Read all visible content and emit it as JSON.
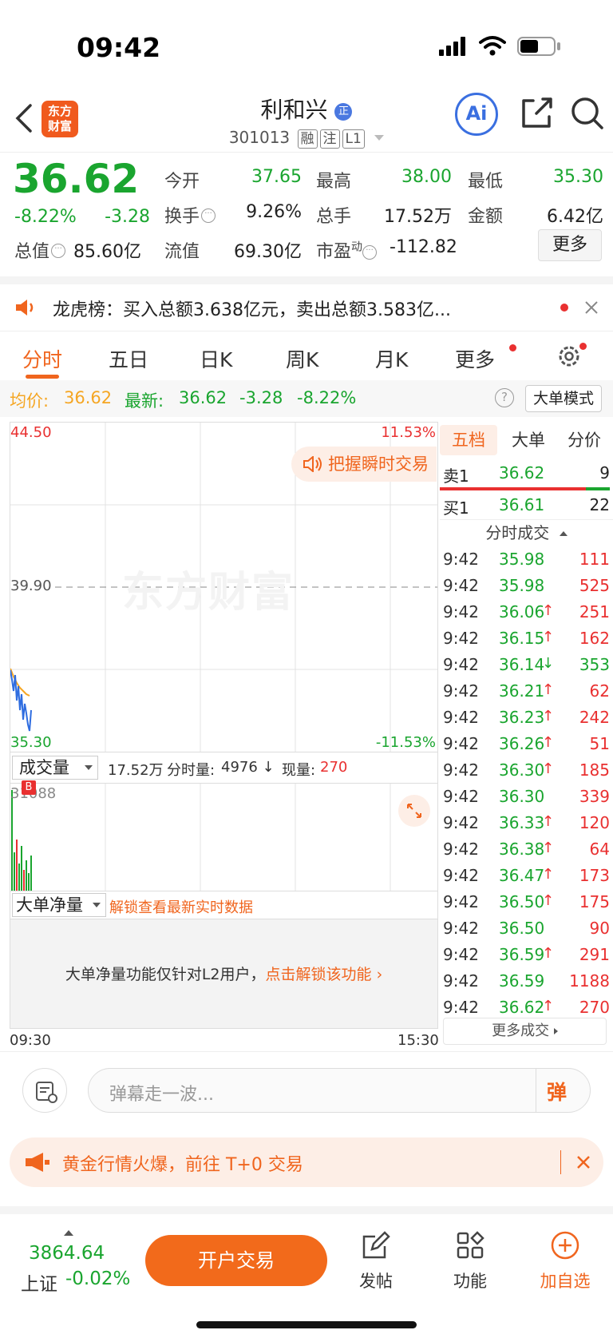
{
  "status": {
    "time": "09:42"
  },
  "header": {
    "logo_line1": "东方",
    "logo_line2": "财富",
    "stock_name": "利和兴",
    "name_badge": "正",
    "stock_code": "301013",
    "tag_rong": "融",
    "tag_zhu": "注",
    "tag_l1": "L1",
    "ai_label": "Ai"
  },
  "quote": {
    "price": "36.62",
    "change_pct": "-8.22%",
    "change": "-3.28",
    "open_label": "今开",
    "open": "37.65",
    "high_label": "最高",
    "high": "38.00",
    "low_label": "最低",
    "low": "35.30",
    "turnover_label": "换手",
    "turnover": "9.26%",
    "volume_label": "总手",
    "volume": "17.52万",
    "amount_label": "金额",
    "amount": "6.42亿",
    "mktcap_label": "总值",
    "mktcap": "85.60亿",
    "float_label": "流值",
    "float": "69.30亿",
    "pe_label": "市盈",
    "pe_sup": "动",
    "pe": "-112.82",
    "more_button": "更多"
  },
  "notice": {
    "text": "龙虎榜：买入总额3.638亿元，卖出总额3.583亿..."
  },
  "tabs": [
    "分时",
    "五日",
    "日K",
    "周K",
    "月K",
    "更多"
  ],
  "pricebar": {
    "avg_label": "均价:",
    "avg": "36.62",
    "last_label": "最新:",
    "last": "36.62",
    "change": "-3.28",
    "change_pct": "-8.22%",
    "mode_button": "大单模式"
  },
  "chart": {
    "y_top": "44.50",
    "y_mid": "39.90",
    "y_bottom": "35.30",
    "pct_top": "11.53%",
    "pct_bottom": "-11.53%",
    "watermark": "东方财富",
    "flash_trade": "把握瞬时交易",
    "time_start": "09:30",
    "time_end": "15:30"
  },
  "volume": {
    "selector": "成交量",
    "total": "17.52万",
    "minute_label": "分时量:",
    "minute": "4976",
    "current_label": "现量:",
    "current": "270",
    "max_tick": "31088",
    "b_marker": "B"
  },
  "bigorder": {
    "selector": "大单净量",
    "unlock_link": "解锁查看最新实时数据",
    "message": "大单净量功能仅针对L2用户，",
    "message_link": "点击解锁该功能"
  },
  "book": {
    "tabs": [
      "五档",
      "大单",
      "分价"
    ],
    "sell1_label": "卖1",
    "sell1_price": "36.62",
    "sell1_vol": "9",
    "buy1_label": "买1",
    "buy1_price": "36.61",
    "buy1_vol": "22",
    "trades_title": "分时成交",
    "trades": [
      {
        "t": "9:42",
        "p": "35.98",
        "a": "",
        "v": "111",
        "pc": "green",
        "vc": "red"
      },
      {
        "t": "9:42",
        "p": "35.98",
        "a": "",
        "v": "525",
        "pc": "green",
        "vc": "red"
      },
      {
        "t": "9:42",
        "p": "36.06",
        "a": "↑",
        "v": "251",
        "pc": "green",
        "vc": "red"
      },
      {
        "t": "9:42",
        "p": "36.15",
        "a": "↑",
        "v": "162",
        "pc": "green",
        "vc": "red"
      },
      {
        "t": "9:42",
        "p": "36.14",
        "a": "↓",
        "v": "353",
        "pc": "green",
        "vc": "green"
      },
      {
        "t": "9:42",
        "p": "36.21",
        "a": "↑",
        "v": "62",
        "pc": "green",
        "vc": "red"
      },
      {
        "t": "9:42",
        "p": "36.23",
        "a": "↑",
        "v": "242",
        "pc": "green",
        "vc": "red"
      },
      {
        "t": "9:42",
        "p": "36.26",
        "a": "↑",
        "v": "51",
        "pc": "green",
        "vc": "red"
      },
      {
        "t": "9:42",
        "p": "36.30",
        "a": "↑",
        "v": "185",
        "pc": "green",
        "vc": "red"
      },
      {
        "t": "9:42",
        "p": "36.30",
        "a": "",
        "v": "339",
        "pc": "green",
        "vc": "red"
      },
      {
        "t": "9:42",
        "p": "36.33",
        "a": "↑",
        "v": "120",
        "pc": "green",
        "vc": "red"
      },
      {
        "t": "9:42",
        "p": "36.38",
        "a": "↑",
        "v": "64",
        "pc": "green",
        "vc": "red"
      },
      {
        "t": "9:42",
        "p": "36.47",
        "a": "↑",
        "v": "173",
        "pc": "green",
        "vc": "red"
      },
      {
        "t": "9:42",
        "p": "36.50",
        "a": "↑",
        "v": "175",
        "pc": "green",
        "vc": "red"
      },
      {
        "t": "9:42",
        "p": "36.50",
        "a": "",
        "v": "90",
        "pc": "green",
        "vc": "red"
      },
      {
        "t": "9:42",
        "p": "36.59",
        "a": "↑",
        "v": "291",
        "pc": "green",
        "vc": "red"
      },
      {
        "t": "9:42",
        "p": "36.59",
        "a": "",
        "v": "1188",
        "pc": "green",
        "vc": "red"
      },
      {
        "t": "9:42",
        "p": "36.62",
        "a": "↑",
        "v": "270",
        "pc": "green",
        "vc": "red"
      }
    ],
    "more_trades": "更多成交"
  },
  "comment": {
    "placeholder": "弹幕走一波...",
    "danmu_button": "弹"
  },
  "promo": {
    "text": "黄金行情火爆，前往 T+0 交易"
  },
  "bottombar": {
    "index_value": "3864.64",
    "index_name": "上证",
    "index_change": "-0.02%",
    "open_account": "开户交易",
    "post": "发帖",
    "function": "功能",
    "add_watch": "加自选"
  },
  "colors": {
    "red": "#e93030",
    "green": "#1aa52f",
    "orange": "#f0651e"
  }
}
